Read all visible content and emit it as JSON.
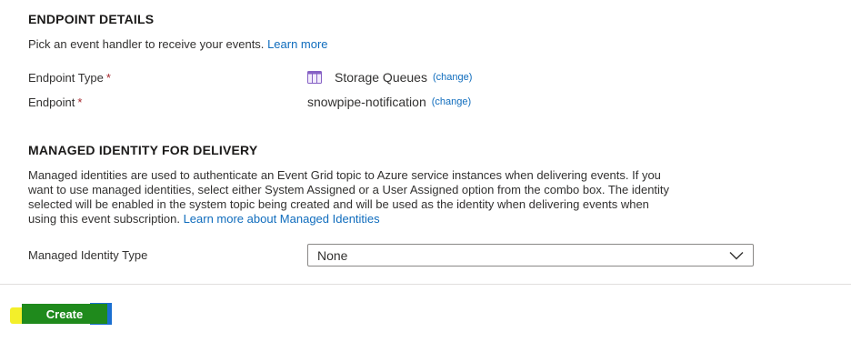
{
  "endpoint": {
    "title": "ENDPOINT DETAILS",
    "description": "Pick an event handler to receive your events.",
    "learn_more": "Learn more",
    "type_label": "Endpoint Type",
    "type_value": "Storage Queues",
    "endpoint_label": "Endpoint",
    "endpoint_value": "snowpipe-notification",
    "required_mark": "*",
    "change_label": "(change)"
  },
  "identity": {
    "title": "MANAGED IDENTITY FOR DELIVERY",
    "line1": "Managed identities are used to authenticate an Event Grid topic to Azure service instances when delivering events. If you",
    "line2": "want to use managed identities, select either System Assigned or a User Assigned option from the combo box. The identity",
    "line3": "selected will be enabled in the system topic being created and will be used as the identity when delivering events when",
    "line4": "using this event subscription.",
    "learn_more": "Learn more about Managed Identities",
    "type_label": "Managed Identity Type",
    "type_value": "None"
  },
  "actions": {
    "create_label": "Create"
  },
  "colors": {
    "link": "#0f6cbd",
    "create_bg": "#1f8a1c",
    "highlight_yellow": "#f3ef2a",
    "highlight_blue": "#1a6fd1",
    "queue_icon": "#8661c5"
  },
  "icons": {
    "endpoint_type": "storage-queue-icon",
    "dropdown": "chevron-down-icon"
  }
}
